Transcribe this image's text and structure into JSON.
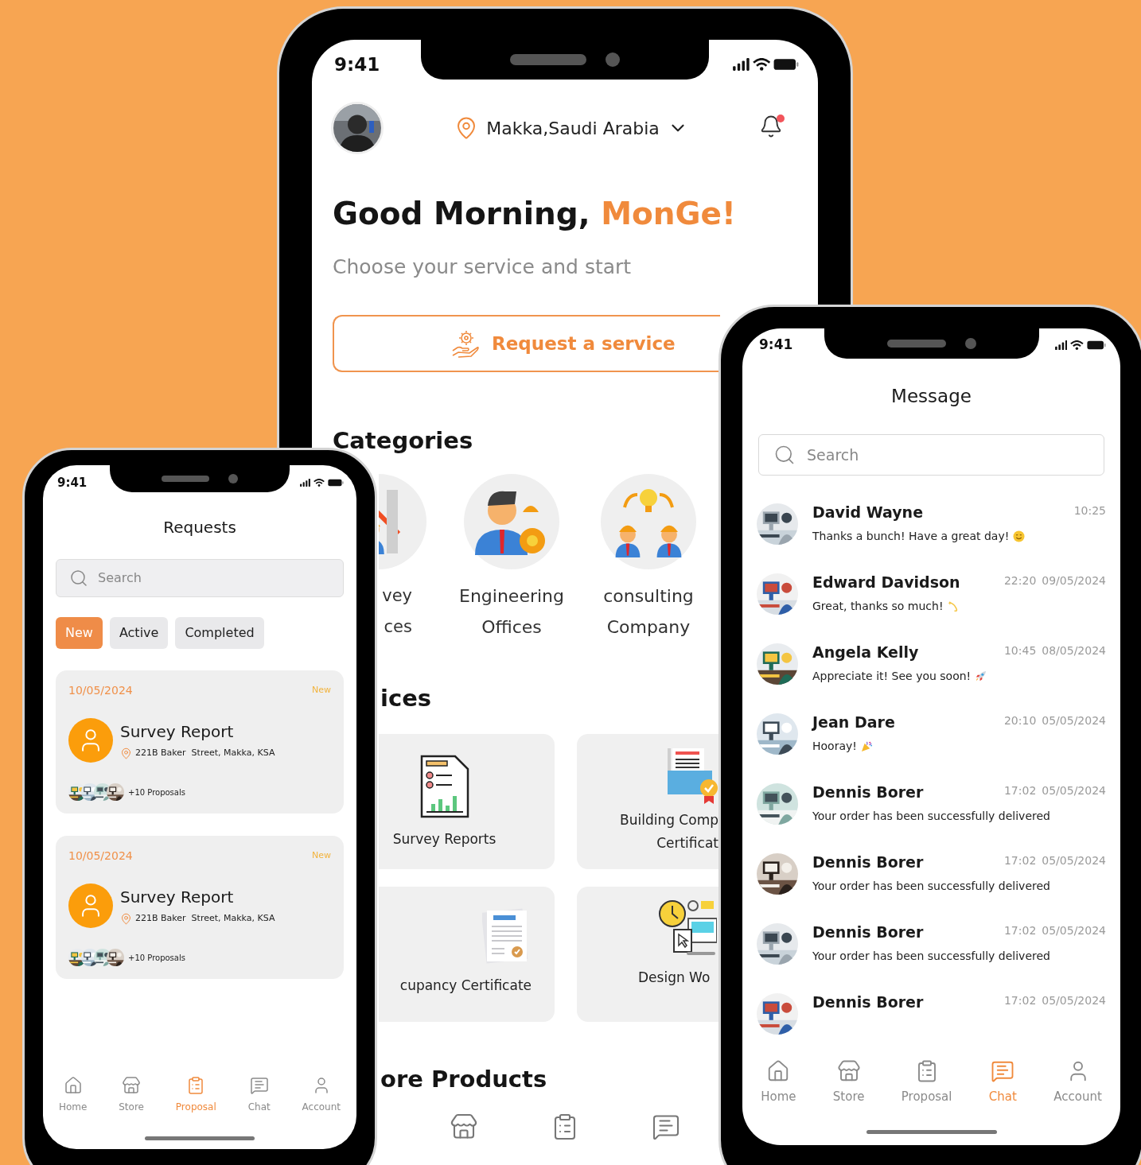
{
  "home": {
    "status_time": "9:41",
    "location": "Makka,Saudi Arabia",
    "notification_dot": true,
    "greeting": "Good Morning, ",
    "greeting_name": "MonGe!",
    "subtitle": "Choose your service and start",
    "request_button": "Request a service",
    "categories_title": "Categories",
    "categories": [
      {
        "lines": [
          "vey",
          "ces"
        ]
      },
      {
        "lines": [
          "Engineering",
          "Offices"
        ]
      },
      {
        "lines": [
          "consulting",
          "Company"
        ]
      }
    ],
    "services_title": "ices",
    "services": [
      {
        "lines": [
          "Survey Reports"
        ]
      },
      {
        "lines": [
          "Building Comp",
          "Certificat"
        ]
      },
      {
        "lines": [
          "cupancy Certificate"
        ]
      },
      {
        "lines": [
          "Design Wo"
        ]
      }
    ],
    "products_title": "ore Products"
  },
  "requests": {
    "status_time": "9:41",
    "title": "Requests",
    "search_placeholder": "Search",
    "filters": [
      {
        "label": "New",
        "selected": true
      },
      {
        "label": "Active",
        "selected": false
      },
      {
        "label": "Completed",
        "selected": false
      }
    ],
    "items": [
      {
        "date": "10/05/2024",
        "status": "New",
        "title": "Survey Report",
        "address": "221B Baker  Street, Makka, KSA",
        "proposals": "+10 Proposals"
      },
      {
        "date": "10/05/2024",
        "status": "New",
        "title": "Survey Report",
        "address": "221B Baker  Street, Makka, KSA",
        "proposals": "+10 Proposals"
      }
    ],
    "nav": [
      {
        "label": "Home",
        "selected": false
      },
      {
        "label": "Store",
        "selected": false
      },
      {
        "label": "Proposal",
        "selected": true
      },
      {
        "label": "Chat",
        "selected": false
      },
      {
        "label": "Account",
        "selected": false
      }
    ]
  },
  "messages": {
    "status_time": "9:41",
    "title": "Message",
    "search_placeholder": "Search",
    "chats": [
      {
        "name": "David Wayne",
        "message": "Thanks a bunch! Have a great day!",
        "kind": "smile",
        "time": "10:25"
      },
      {
        "name": "Edward Davidson",
        "message": "Great, thanks so much!",
        "kind": "sparkle",
        "time": "22:20",
        "date": "09/05/2024"
      },
      {
        "name": "Angela Kelly",
        "message": "Appreciate it! See you soon!",
        "kind": "rocket",
        "time": "10:45",
        "date": "08/05/2024"
      },
      {
        "name": "Jean Dare",
        "message": "Hooray!",
        "kind": "party",
        "time": "20:10",
        "date": "05/05/2024"
      },
      {
        "name": "Dennis Borer",
        "message": "Your order has been successfully delivered",
        "kind": "plain",
        "time": "17:02",
        "date": "05/05/2024"
      },
      {
        "name": "Dennis Borer",
        "message": "Your order has been successfully delivered",
        "kind": "plain",
        "time": "17:02",
        "date": "05/05/2024"
      },
      {
        "name": "Dennis Borer",
        "message": "Your order has been successfully delivered",
        "kind": "plain",
        "time": "17:02",
        "date": "05/05/2024"
      },
      {
        "name": "Dennis Borer",
        "time": "17:02",
        "date": "05/05/2024"
      }
    ],
    "nav": [
      {
        "label": "Home",
        "selected": false
      },
      {
        "label": "Store",
        "selected": false
      },
      {
        "label": "Proposal",
        "selected": false
      },
      {
        "label": "Chat",
        "selected": true
      },
      {
        "label": "Account",
        "selected": false
      }
    ]
  }
}
